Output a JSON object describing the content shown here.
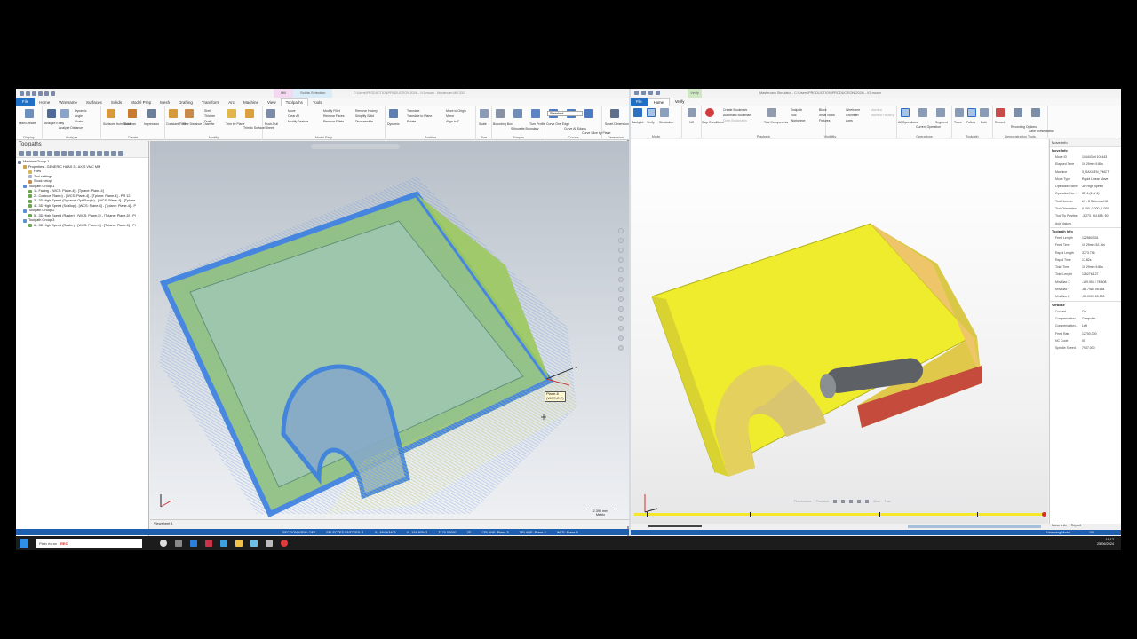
{
  "left": {
    "title": "C:\\Users\\PRODUCTION\\PRODUCTION 2024\\...\\V3.mcam - Mastercam Mill 2024",
    "context_tabs": [
      "Mill",
      "Solids Selection"
    ],
    "tabs": [
      "File",
      "Home",
      "Wireframe",
      "Surfaces",
      "Solids",
      "Model Prep",
      "Mesh",
      "Drafting",
      "Transform",
      "Arc",
      "Machine",
      "View",
      "Toolpaths",
      "Tools"
    ],
    "active_tab": "Toolpaths",
    "dropdown": "Standard",
    "my_mastercam": "My Mastercam",
    "ribbon_groups": [
      "Display",
      "Analyze",
      "Create",
      "Modify",
      "Model Prep",
      "Position",
      "Size",
      "Shapes",
      "Curves",
      "Dimension"
    ],
    "ribbon_buttons": [
      "Hide/Unhide",
      "Analyze Entity",
      "Analyze Distance",
      "Dynamic",
      "Angle",
      "Chain",
      "Surfaces from Solids",
      "Boolean",
      "Impression",
      "Constant Fillet",
      "One Distance Chamfer",
      "Shell",
      "Thicken",
      "Draft",
      "Trim by Plane",
      "Trim to Surface/Sheet",
      "Push-Pull",
      "Move",
      "Clear All",
      "Modify Feature",
      "Modify Fillet",
      "Remove Faces",
      "Remove Fillets",
      "Remove History",
      "Simplify Solid",
      "Disassemble",
      "Dynamic",
      "Translate",
      "Translate to Plane",
      "Rotate",
      "Move to Origin",
      "Mirror",
      "Align to Z",
      "Scale",
      "Bounding Box",
      "Silhouette Boundary",
      "Turn Profile",
      "Curve One Edge",
      "Curve All Edges",
      "Curve Slice by Plane",
      "Smart Dimension"
    ],
    "panel_title": "Toolpaths",
    "tree": [
      {
        "label": "Machine Group-1",
        "indent": 0,
        "color": "#6f7fa0"
      },
      {
        "label": "Properties - GENERIC HAAS 3 - AXIS VMC MM",
        "indent": 1,
        "color": "#c9a24b"
      },
      {
        "label": "Files",
        "indent": 2,
        "color": "#d8b45a"
      },
      {
        "label": "Tool settings",
        "indent": 2,
        "color": "#a7b3c8"
      },
      {
        "label": "Stock setup",
        "indent": 2,
        "color": "#c98b4b"
      },
      {
        "label": "Toolpath Group-1",
        "indent": 1,
        "color": "#5c8fd6"
      },
      {
        "label": "1 - Facing - [WCS: Plane-4] - [Tplane: Plane-4]",
        "indent": 2,
        "color": "#6aa84f"
      },
      {
        "label": "2 - Contour (Ramp) - [WCS: Plane-4] - [Tplane: Plane-4] - PR 12",
        "indent": 2,
        "color": "#6aa84f"
      },
      {
        "label": "3 - 3D High Speed (Dynamic OptiRough) - [WCS: Plane-4] - [Tplane",
        "indent": 2,
        "color": "#6aa84f"
      },
      {
        "label": "4 - 3D High Speed (Scallop) - [WCS: Plane-4] - [Tplane: Plane-4] - P",
        "indent": 2,
        "color": "#6aa84f"
      },
      {
        "label": "Toolpath Group-2",
        "indent": 1,
        "color": "#5c8fd6"
      },
      {
        "label": "5 - 3D High Speed (Raster) - [WCS: Plane-5] - [Tplane: Plane-5] - Pl",
        "indent": 2,
        "color": "#6aa84f"
      },
      {
        "label": "Toolpath Group-3",
        "indent": 1,
        "color": "#5c8fd6"
      },
      {
        "label": "6 - 3D High Speed (Raster) - [WCS: Plane-6] - [Tplane: Plane-6] - Pl",
        "indent": 2,
        "color": "#6aa84f"
      }
    ],
    "panel_tabs": [
      "Toolpaths",
      "Solids",
      "Planes",
      "Levels",
      "Recent Functions"
    ],
    "viewsheet_tab": "Viewsheet 1",
    "plane_label_1": "Plane-6",
    "plane_label_2": "(WCS,C,T)",
    "axis_y": "Y",
    "scale_value": "2.390 mm",
    "scale_unit": "Metric",
    "status": [
      "SECTION VIEW: OFF",
      "SELECTED ENTITIES: 1",
      "X: -664.63406",
      "Y: -154.80042",
      "Z: 70.00000",
      "2D",
      "CPLANE: Plane-5",
      "TPLANE: Plane-5",
      "WCS: Plane-5"
    ]
  },
  "right": {
    "title": "Mastercam Simulator - C:\\Users\\PRODUCTION\\PRODUCTION 2024\\...V3.mcam",
    "verify_tab": "Verify",
    "tabs": [
      "File",
      "Home",
      "Verify"
    ],
    "active_tab": "Home",
    "ribbon_groups": [
      "Mode",
      "Playback",
      "Visibility",
      "Operations",
      "Toolpath",
      "Demonstration Tools"
    ],
    "ribbon_buttons": [
      "Backplot",
      "Verify",
      "Simulation",
      "NC",
      "Stop Conditions",
      "Create Bookmark",
      "Automatic Bookmark",
      "Clear Bookmarks",
      "Tool Components",
      "Toolpath",
      "Tool",
      "Workpiece",
      "Block",
      "Initial Stock",
      "Fixtures",
      "Wireframe",
      "Grometer",
      "Axes",
      "Machine",
      "Machine Housing",
      "All Operations",
      "Current Operation",
      "Segment",
      "Trace",
      "Follow",
      "Both",
      "Record",
      "Recording Options",
      "Save Presentation"
    ],
    "playback": [
      "Performance",
      "Precision",
      "Slow",
      "Fast"
    ],
    "panel_title": "Move Info",
    "move_info": [
      {
        "k": "Move ID",
        "v": "104443 of 104443"
      },
      {
        "k": "Elapsed Time",
        "v": "1h 29min 9.88s"
      },
      {
        "k": "Machine",
        "v": "3_SAXGEN_VMCT"
      },
      {
        "k": "Move Type",
        "v": "Rapid Linear Move"
      },
      {
        "k": "Operation Name",
        "v": "3D High Speed"
      },
      {
        "k": "Operation Nu...",
        "v": "ID: 6 (6 of 6)"
      },
      {
        "k": "Tool Number",
        "v": "#7 - 8 Spherical Mi"
      },
      {
        "k": "Tool Orientation",
        "v": "0.000, 0.000, 1.000"
      },
      {
        "k": "Tool Tip Position",
        "v": "-3.270, -64.655, 50"
      },
      {
        "k": "Axis Values",
        "v": ""
      }
    ],
    "toolpath_info_title": "Toolpath Info",
    "toolpath_info": [
      {
        "k": "Feed Length",
        "v": "122560.331"
      },
      {
        "k": "Feed Time",
        "v": "1h 29min 52.16s"
      },
      {
        "k": "Rapid Length",
        "v": "3773.796"
      },
      {
        "k": "Rapid Time",
        "v": "17.82s"
      },
      {
        "k": "Total Time",
        "v": "1h 29min 9.88s"
      },
      {
        "k": "Total Length",
        "v": "126276.127"
      },
      {
        "k": "Min/Max X",
        "v": "-109.906 / 78.408"
      },
      {
        "k": "Min/Max Y",
        "v": "-84.748 / 98.664"
      },
      {
        "k": "Min/Max Z",
        "v": "-56.000 / 80.000"
      }
    ],
    "verbose_title": "Verbose",
    "verbose": [
      {
        "k": "Coolant",
        "v": "On"
      },
      {
        "k": "Compensation...",
        "v": "Computer"
      },
      {
        "k": "Compensation...",
        "v": "Left"
      },
      {
        "k": "Feed Rate",
        "v": "12700.000"
      },
      {
        "k": "NC Code",
        "v": "00"
      },
      {
        "k": "Spindle Speed",
        "v": "7937.000"
      }
    ],
    "move_section": "Move Info",
    "panel_tabs": [
      "Move Info",
      "Report"
    ],
    "status": "Enhancing Model",
    "status_pct": "100"
  },
  "taskbar": {
    "search": "Plein écran",
    "rec": "REC",
    "time": "16:12",
    "date": "25/06/2024"
  },
  "colors": {
    "accent": "#1f6fc5",
    "statusbar": "#1f5fb0",
    "part_yellow": "#f2ef2a",
    "toolpath_blue": "#3a7fe0"
  }
}
